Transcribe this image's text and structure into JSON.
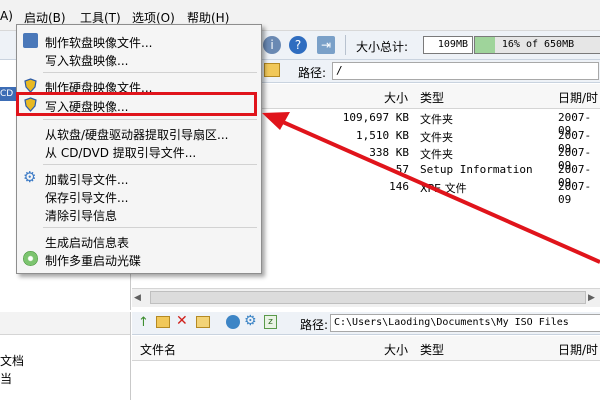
{
  "menubar": {
    "items": [
      "A)",
      "启动(B)",
      "工具(T)",
      "选项(O)",
      "帮助(H)"
    ]
  },
  "toolbar": {
    "size_label": "大小总计:",
    "size_value": "109MB",
    "progress_text": "16% of 650MB",
    "progress_fraction": 0.16
  },
  "top_path": {
    "label": "路径:",
    "value": "/"
  },
  "top_table": {
    "headers": [
      "大小",
      "类型",
      "日期/时"
    ],
    "rows": [
      {
        "size": "109,697 KB",
        "type": "文件夹",
        "date": "2007-09"
      },
      {
        "size": "1,510 KB",
        "type": "文件夹",
        "date": "2007-09"
      },
      {
        "size": "338 KB",
        "type": "文件夹",
        "date": "2007-09"
      },
      {
        "size": "57",
        "type": "Setup Information",
        "date": "2007-09"
      },
      {
        "size": "146",
        "type": "XPE 文件",
        "date": "2007-09"
      }
    ]
  },
  "bottom_path": {
    "label": "路径:",
    "value": "C:\\Users\\Laoding\\Documents\\My ISO Files"
  },
  "bottom_table": {
    "headers": [
      "文件名",
      "大小",
      "类型",
      "日期/时"
    ]
  },
  "left_top": {
    "items": [
      "CD"
    ]
  },
  "left_bottom": {
    "items": [
      "文档",
      "当"
    ]
  },
  "dropdown": {
    "items": [
      {
        "label": "制作软盘映像文件...",
        "icon": "floppy-icon"
      },
      {
        "label": "写入软盘映像..."
      },
      {
        "label": "制作硬盘映像文件...",
        "icon": "shield-icon"
      },
      {
        "label": "写入硬盘映像...",
        "icon": "shield-icon"
      },
      {
        "label": "从软盘/硬盘驱动器提取引导扇区..."
      },
      {
        "label": "从 CD/DVD 提取引导文件..."
      },
      {
        "label": "加载引导文件...",
        "icon": "gear-icon"
      },
      {
        "label": "保存引导文件..."
      },
      {
        "label": "清除引导信息"
      },
      {
        "label": "生成启动信息表"
      },
      {
        "label": "制作多重启动光碟",
        "icon": "disc-icon"
      }
    ]
  },
  "colors": {
    "highlight": "#e0141b",
    "arrow": "#e0141b",
    "progress": "#9fd49b"
  }
}
